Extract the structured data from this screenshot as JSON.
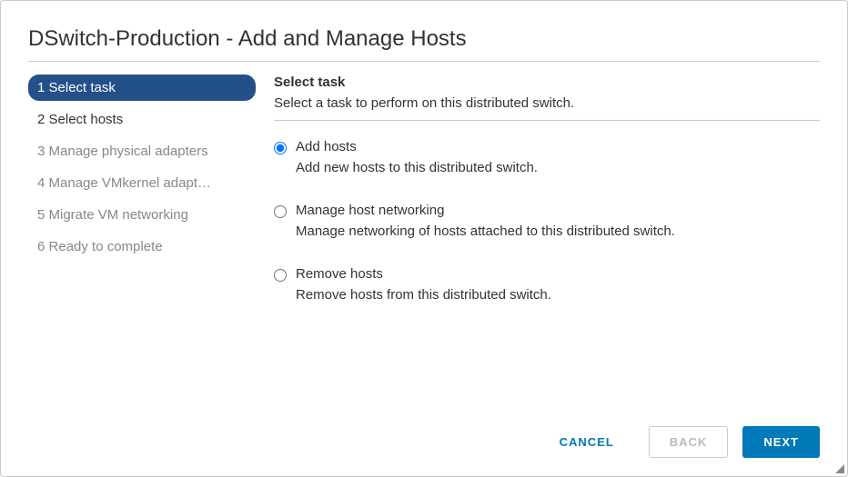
{
  "dialog": {
    "title": "DSwitch-Production - Add and Manage Hosts"
  },
  "steps": [
    {
      "num": "1",
      "label": "Select task",
      "state": "active"
    },
    {
      "num": "2",
      "label": "Select hosts",
      "state": "enabled"
    },
    {
      "num": "3",
      "label": "Manage physical adapters",
      "state": "disabled"
    },
    {
      "num": "4",
      "label": "Manage VMkernel adapt…",
      "state": "disabled"
    },
    {
      "num": "5",
      "label": "Migrate VM networking",
      "state": "disabled"
    },
    {
      "num": "6",
      "label": "Ready to complete",
      "state": "disabled"
    }
  ],
  "main": {
    "title": "Select task",
    "subtitle": "Select a task to perform on this distributed switch.",
    "options": [
      {
        "id": "add",
        "label": "Add hosts",
        "desc": "Add new hosts to this distributed switch.",
        "selected": true
      },
      {
        "id": "manage",
        "label": "Manage host networking",
        "desc": "Manage networking of hosts attached to this distributed switch.",
        "selected": false
      },
      {
        "id": "remove",
        "label": "Remove hosts",
        "desc": "Remove hosts from this distributed switch.",
        "selected": false
      }
    ]
  },
  "footer": {
    "cancel": "CANCEL",
    "back": "BACK",
    "next": "NEXT"
  }
}
